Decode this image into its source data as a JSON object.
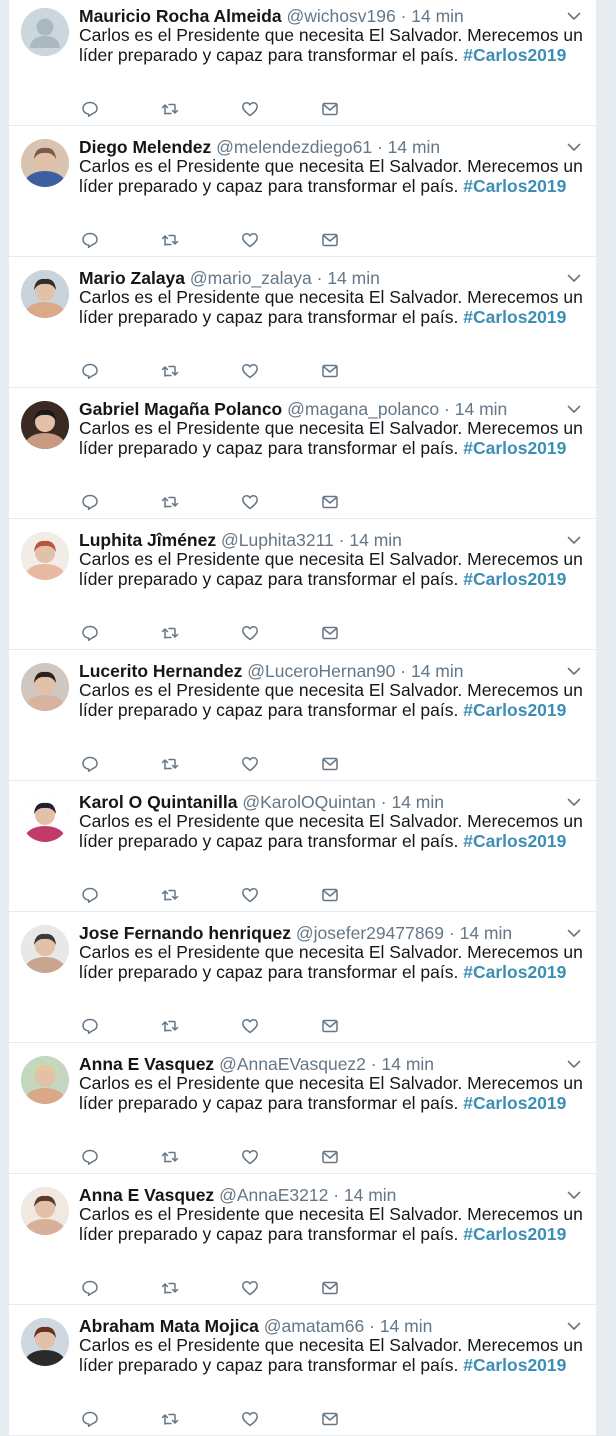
{
  "colors": {
    "background": "#e6ecf0",
    "hashtag": "#3c8fb4",
    "muted": "#657786",
    "text": "#14171a"
  },
  "feed": {
    "tweets": [
      {
        "name": "Mauricio Rocha Almeida",
        "handle": "@wichosv196",
        "separator": "·",
        "time": "14 min",
        "text": "Carlos es el Presidente que necesita El Salvador. Merecemos un líder preparado y capaz para transformar el país.",
        "hashtag": "#Carlos2019",
        "avatar": "default-profile-icon"
      },
      {
        "name": "Diego Melendez",
        "handle": "@melendezdiego61",
        "separator": "·",
        "time": "14 min",
        "text": "Carlos es el Presidente que necesita El Salvador. Merecemos un líder preparado y capaz para transformar el país.",
        "hashtag": "#Carlos2019",
        "avatar": "profile-photo"
      },
      {
        "name": "Mario Zalaya",
        "handle": "@mario_zalaya",
        "separator": "·",
        "time": "14 min",
        "text": "Carlos es el Presidente que necesita El Salvador. Merecemos un líder preparado y capaz para transformar el país.",
        "hashtag": "#Carlos2019",
        "avatar": "profile-photo"
      },
      {
        "name": "Gabriel Magaña Polanco",
        "handle": "@magana_polanco",
        "separator": "·",
        "time": "14 min",
        "text": "Carlos es el Presidente que necesita El Salvador. Merecemos un líder preparado y capaz para transformar el país.",
        "hashtag": "#Carlos2019",
        "avatar": "profile-photo"
      },
      {
        "name": "Luphita Jîménez",
        "handle": "@Luphita3211",
        "separator": "·",
        "time": "14 min",
        "text": "Carlos es el Presidente que necesita El Salvador. Merecemos un líder preparado y capaz para transformar el país.",
        "hashtag": "#Carlos2019",
        "avatar": "profile-photo"
      },
      {
        "name": "Lucerito Hernandez",
        "handle": "@LuceroHernan90",
        "separator": "·",
        "time": "14 min",
        "text": "Carlos es el Presidente que necesita El Salvador. Merecemos un líder preparado y capaz para transformar el país.",
        "hashtag": "#Carlos2019",
        "avatar": "profile-photo"
      },
      {
        "name": "Karol O Quintanilla",
        "handle": "@KarolOQuintan",
        "separator": "·",
        "time": "14 min",
        "text": "Carlos es el Presidente que necesita El Salvador. Merecemos un líder preparado y capaz para transformar el país.",
        "hashtag": "#Carlos2019",
        "avatar": "profile-photo"
      },
      {
        "name": "Jose Fernando henriquez",
        "handle": "@josefer29477869",
        "separator": "·",
        "time": "14 min",
        "text": "Carlos es el Presidente que necesita El Salvador. Merecemos un líder preparado y capaz para transformar el país.",
        "hashtag": "#Carlos2019",
        "avatar": "profile-photo"
      },
      {
        "name": "Anna E Vasquez",
        "handle": "@AnnaEVasquez2",
        "separator": "·",
        "time": "14 min",
        "text": "Carlos es el Presidente que necesita El Salvador. Merecemos un líder preparado y capaz para transformar el país.",
        "hashtag": "#Carlos2019",
        "avatar": "profile-photo"
      },
      {
        "name": "Anna E Vasquez",
        "handle": "@AnnaE3212",
        "separator": "·",
        "time": "14 min",
        "text": "Carlos es el Presidente que necesita El Salvador. Merecemos un líder preparado y capaz para transformar el país.",
        "hashtag": "#Carlos2019",
        "avatar": "profile-photo"
      },
      {
        "name": "Abraham Mata Mojica",
        "handle": "@amatam66",
        "separator": "·",
        "time": "14 min",
        "text": "Carlos es el Presidente que necesita El Salvador. Merecemos un líder preparado y capaz para transformar el país.",
        "hashtag": "#Carlos2019",
        "avatar": "profile-photo"
      }
    ]
  }
}
